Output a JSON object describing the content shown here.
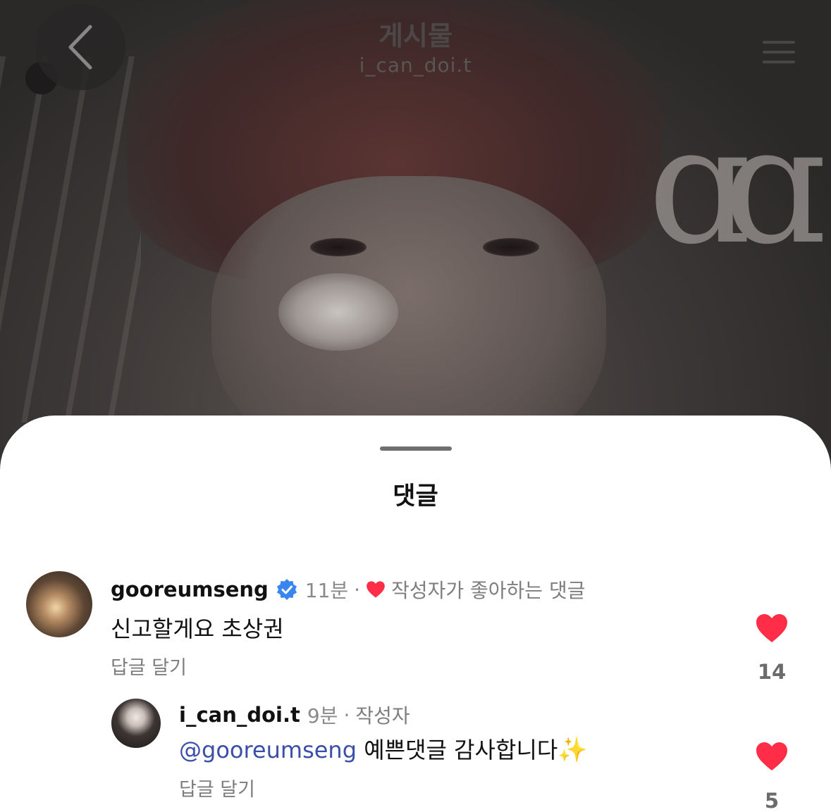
{
  "nav": {
    "title": "게시물",
    "subtitle": "i_can_doi.t",
    "back_icon": "chevron-left-icon",
    "menu_icon": "hamburger-icon"
  },
  "sheet": {
    "title": "댓글"
  },
  "comments": [
    {
      "username": "gooreumseng",
      "verified": true,
      "time": "11분",
      "author_liked_label": "작성자가 좋아하는 댓글",
      "text": "신고할게요 초상권",
      "reply_label": "답글 달기",
      "like_count": "14",
      "liked": true
    },
    {
      "username": "i_can_doi.t",
      "time": "9분",
      "author_badge": "작성자",
      "mention": "@gooreumseng",
      "text": "예쁜댓글 감사합니다",
      "emoji": "✨",
      "reply_label": "답글 달기",
      "like_count": "5",
      "liked": true
    }
  ],
  "colors": {
    "like_red": "#ff2d47",
    "verified_blue": "#3a86f0",
    "mention_blue": "#3b4fa8"
  }
}
